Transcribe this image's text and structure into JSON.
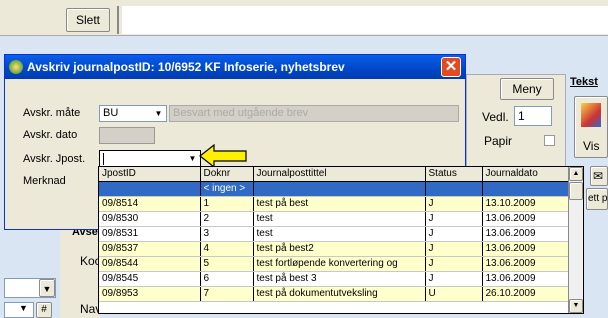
{
  "background": {
    "slett_label": "Slett",
    "meny_label": "Meny",
    "tekst_label": "Tekst",
    "vedl_label": "Vedl.",
    "vedl_value": "1",
    "papir_label": "Papir",
    "vis_label": "Vis",
    "ett_label": "ett p",
    "avse_label": "Avse",
    "koc_label": "Koc",
    "nav_label": "Navn"
  },
  "dialog": {
    "title": "Avskriv journalpostID: 10/6952 KF Infoserie, nyhetsbrev",
    "close_label": "✕",
    "avskr_mate_label": "Avskr. måte",
    "avskr_mate_value": "BU",
    "avskr_mate_desc": "Besvart med utgående brev",
    "avskr_dato_label": "Avskr. dato",
    "avskr_jpost_label": "Avskr. Jpost.",
    "merknad_label": "Merknad"
  },
  "grid": {
    "columns": [
      "JpostID",
      "Doknr",
      "Journalposttittel",
      "Status",
      "Journaldato"
    ],
    "ingen_label": "< ingen >",
    "rows": [
      {
        "id": "09/8514",
        "doknr": "1",
        "title": "test på best",
        "status": "J",
        "date": "13.10.2009"
      },
      {
        "id": "09/8530",
        "doknr": "2",
        "title": "test",
        "status": "J",
        "date": "13.06.2009"
      },
      {
        "id": "09/8531",
        "doknr": "3",
        "title": "test",
        "status": "J",
        "date": "13.06.2009"
      },
      {
        "id": "09/8537",
        "doknr": "4",
        "title": "test på best2",
        "status": "J",
        "date": "13.06.2009"
      },
      {
        "id": "09/8544",
        "doknr": "5",
        "title": "test fortløpende konvertering og",
        "status": "J",
        "date": "13.06.2009"
      },
      {
        "id": "09/8545",
        "doknr": "6",
        "title": "test på best 3",
        "status": "J",
        "date": "13.06.2009"
      },
      {
        "id": "09/8953",
        "doknr": "7",
        "title": "test på dokumentutveksling",
        "status": "U",
        "date": "26.10.2009"
      }
    ]
  },
  "colors": {
    "title_bar": "#0a5ee6",
    "selection": "#316ac5",
    "row_highlight": "#ffffcc",
    "arrow": "#ffef00"
  }
}
